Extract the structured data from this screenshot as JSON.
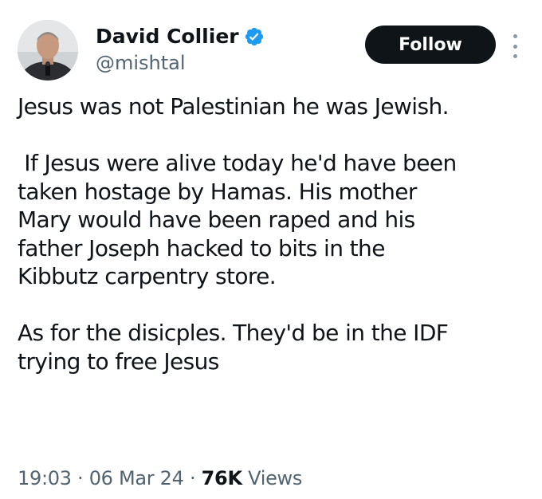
{
  "author": {
    "display_name": "David Collier",
    "handle": "@mishtal",
    "verified": true,
    "verified_badge_color": "#1d9bf0",
    "avatar_icon": "profile-photo"
  },
  "actions": {
    "follow_label": "Follow",
    "more_icon": "vertical-ellipsis-icon"
  },
  "tweet": {
    "lines": [
      "Jesus was not Palestinian he was Jewish.",
      "",
      " If Jesus were alive today he'd have been",
      "taken hostage by Hamas. His mother",
      "Mary would have been raped and his",
      "father Joseph hacked to bits in the",
      "Kibbutz carpentry store.",
      "",
      "As for the disicples. They'd be in the IDF",
      "trying to free Jesus"
    ]
  },
  "meta": {
    "time": "19:03",
    "date": "06 Mar 24",
    "views_count": "76K",
    "views_label": "Views",
    "separator": "·"
  }
}
